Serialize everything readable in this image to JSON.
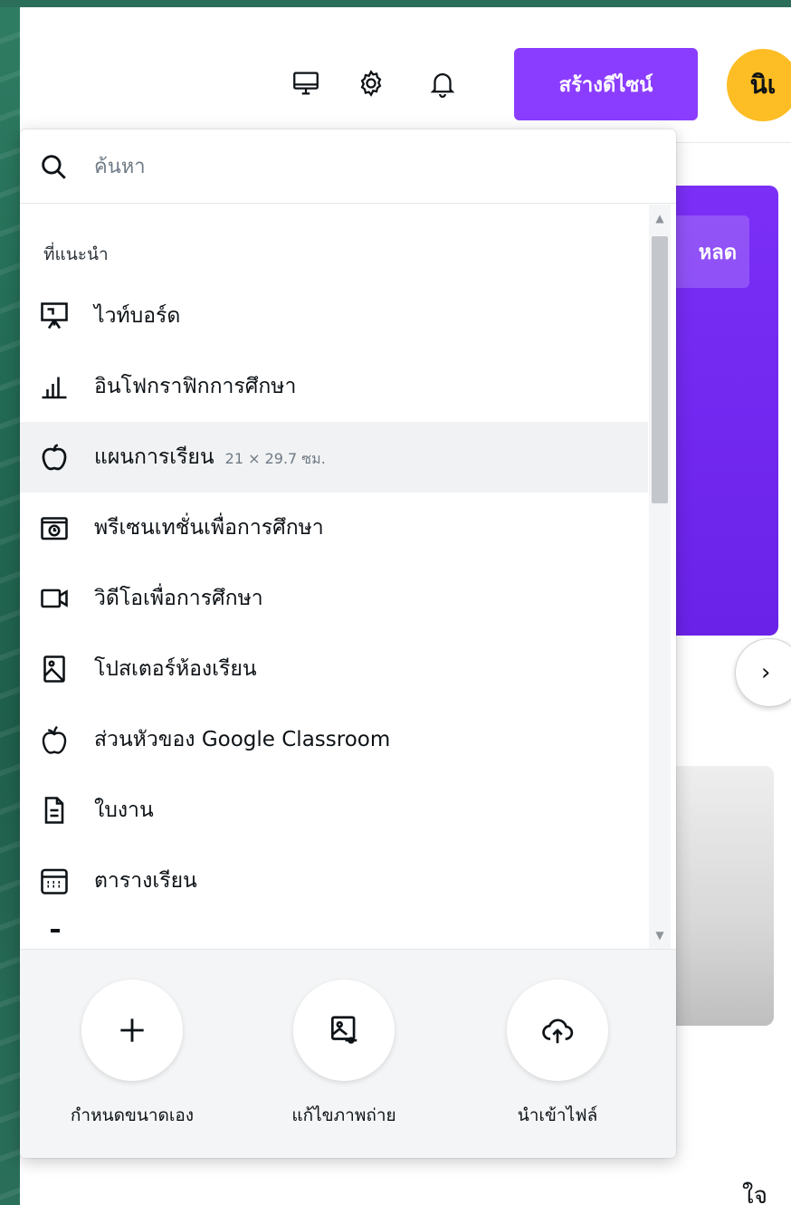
{
  "topbar": {
    "icons": [
      "desktop-icon",
      "gear-icon",
      "bell-icon"
    ],
    "create_button_label": "สร้างดีไซน์",
    "avatar_initials": "นิเ"
  },
  "background": {
    "promo_button_label": "หลด",
    "next_arrow": "›",
    "corner_glyph": "ใจ"
  },
  "dropdown": {
    "search": {
      "placeholder": "ค้นหา",
      "value": ""
    },
    "section_heading": "ที่แนะนำ",
    "items": [
      {
        "label": "ไวท์บอร์ด",
        "icon": "whiteboard-icon"
      },
      {
        "label": "อินโฟกราฟิกการศึกษา",
        "icon": "bar-chart-icon"
      },
      {
        "label": "แผนการเรียน",
        "dims": "21 × 29.7 ซม.",
        "icon": "apple-icon"
      },
      {
        "label": "พรีเซนเทชั่นเพื่อการศึกษา",
        "icon": "presentation-icon"
      },
      {
        "label": "วิดีโอเพื่อการศึกษา",
        "icon": "video-camera-icon"
      },
      {
        "label": "โปสเตอร์ห้องเรียน",
        "icon": "poster-icon"
      },
      {
        "label": "ส่วนหัวของ Google Classroom",
        "icon": "apple-icon"
      },
      {
        "label": "ใบงาน",
        "icon": "document-icon"
      },
      {
        "label": "ตารางเรียน",
        "icon": "calendar-icon"
      }
    ],
    "actions": [
      {
        "label": "กำหนดขนาดเอง",
        "icon": "plus-icon"
      },
      {
        "label": "แก้ไขภาพถ่าย",
        "icon": "edit-photo-icon"
      },
      {
        "label": "นำเข้าไฟล์",
        "icon": "cloud-upload-icon"
      }
    ]
  },
  "colors": {
    "accent": "#8b3dff",
    "avatar_bg": "#fdbd24",
    "hover_row": "#f1f2f3"
  }
}
